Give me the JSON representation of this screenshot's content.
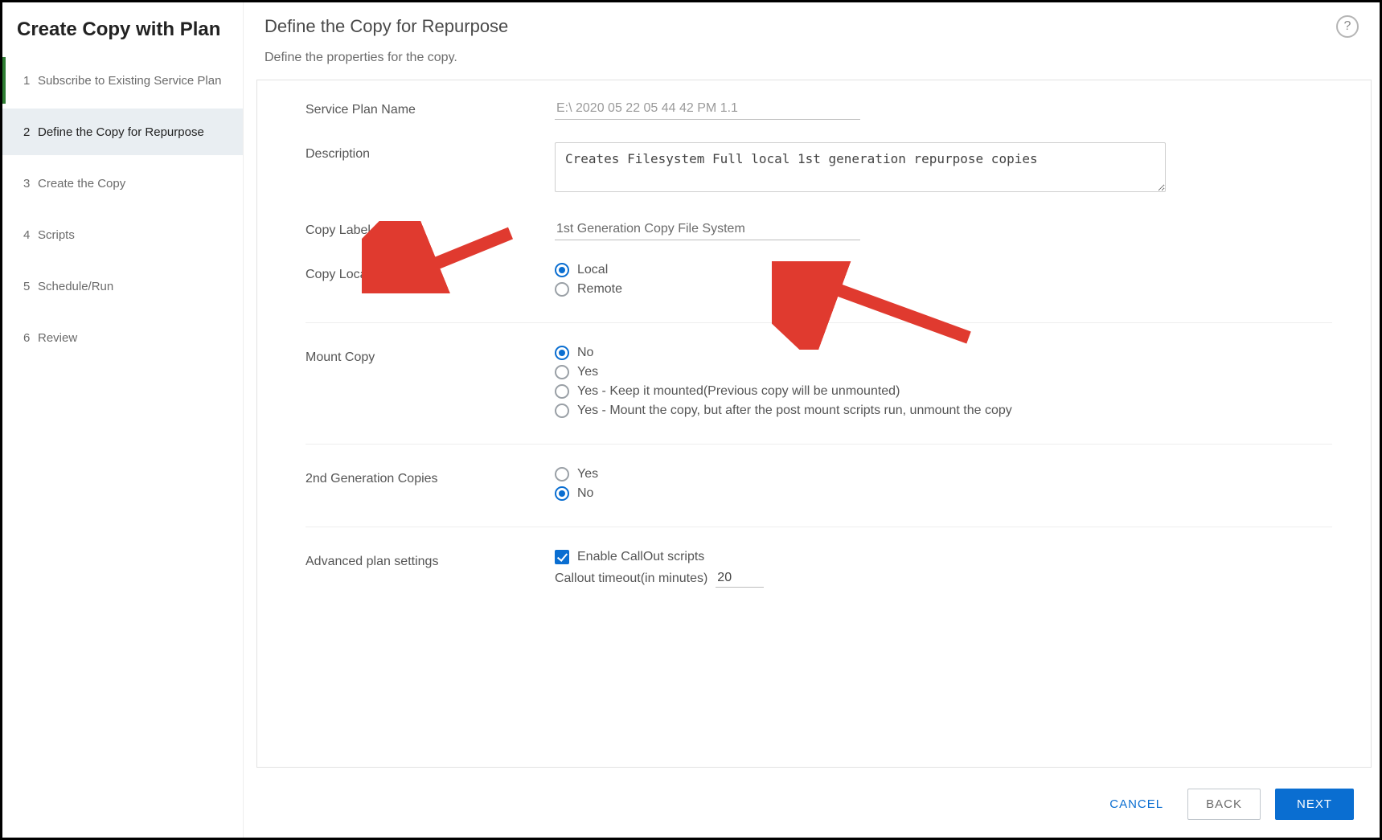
{
  "sidebar": {
    "title": "Create Copy with Plan",
    "steps": [
      {
        "num": "1",
        "label": "Subscribe to Existing Service Plan"
      },
      {
        "num": "2",
        "label": "Define the Copy for Repurpose"
      },
      {
        "num": "3",
        "label": "Create the Copy"
      },
      {
        "num": "4",
        "label": "Scripts"
      },
      {
        "num": "5",
        "label": "Schedule/Run"
      },
      {
        "num": "6",
        "label": "Review"
      }
    ],
    "active_index": 1
  },
  "header": {
    "title": "Define the Copy for Repurpose",
    "subtitle": "Define the properties for the copy.",
    "help_tooltip": "?"
  },
  "form": {
    "service_plan_name": {
      "label": "Service Plan Name",
      "value": "E:\\ 2020 05 22 05 44 42 PM 1.1"
    },
    "description": {
      "label": "Description",
      "value": "Creates Filesystem Full local 1st generation repurpose copies"
    },
    "copy_label": {
      "label": "Copy Label",
      "value": "1st Generation Copy File System"
    },
    "copy_location": {
      "label": "Copy Location",
      "options": [
        "Local",
        "Remote"
      ],
      "selected": "Local"
    },
    "mount_copy": {
      "label": "Mount Copy",
      "options": [
        "No",
        "Yes",
        "Yes - Keep it mounted(Previous copy will be unmounted)",
        "Yes - Mount the copy, but after the post mount scripts run, unmount the copy"
      ],
      "selected": "No"
    },
    "second_gen": {
      "label": "2nd Generation Copies",
      "options": [
        "Yes",
        "No"
      ],
      "selected": "No"
    },
    "advanced": {
      "label": "Advanced plan settings",
      "enable_callout_label": "Enable CallOut scripts",
      "enable_callout_checked": true,
      "timeout_label": "Callout timeout(in minutes)",
      "timeout_value": "20"
    }
  },
  "footer": {
    "cancel": "CANCEL",
    "back": "BACK",
    "next": "NEXT"
  }
}
